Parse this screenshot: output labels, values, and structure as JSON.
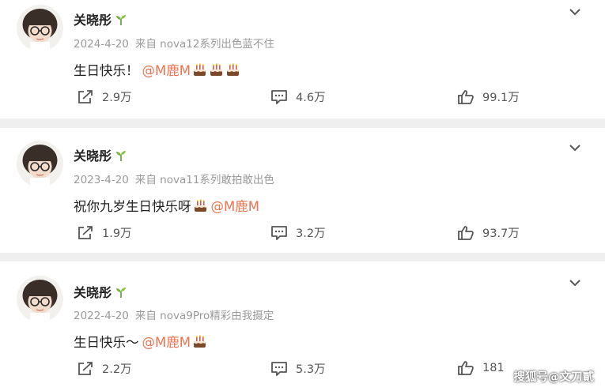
{
  "colors": {
    "mention": "#eb7350",
    "text": "#1f1f1f",
    "meta": "#9a9a9a",
    "background": "#efefef"
  },
  "posts": [
    {
      "username": "关晓彤",
      "date": "2024-4-20",
      "source": "来自 nova12系列出色蓝不住",
      "text": "生日快乐！",
      "mention": "@M鹿M",
      "cakes": 3,
      "shares": "2.9万",
      "comments": "4.6万",
      "likes": "99.1万"
    },
    {
      "username": "关晓彤",
      "date": "2023-4-20",
      "source": "来自 nova11系列敢拍敢出色",
      "text": "祝你九岁生日快乐呀",
      "mention": "@M鹿M",
      "cakes": 1,
      "shares": "1.9万",
      "comments": "3.2万",
      "likes": "93.7万"
    },
    {
      "username": "关晓彤",
      "date": "2022-4-20",
      "source": "来自 nova9Pro精彩由我摄定",
      "text": "生日快乐～",
      "mention": "@M鹿M",
      "cakes": 1,
      "shares": "2.2万",
      "comments": "5.3万",
      "likes": "181"
    }
  ],
  "watermark": "搜狐号@文刀貳",
  "icons": {
    "avatar": "avatar-image",
    "badge": "sprout-icon",
    "more": "chevron-down-icon",
    "emoji": "birthday-cake-icon",
    "share": "share-icon",
    "comment": "comment-icon",
    "like": "thumbs-up-icon"
  }
}
